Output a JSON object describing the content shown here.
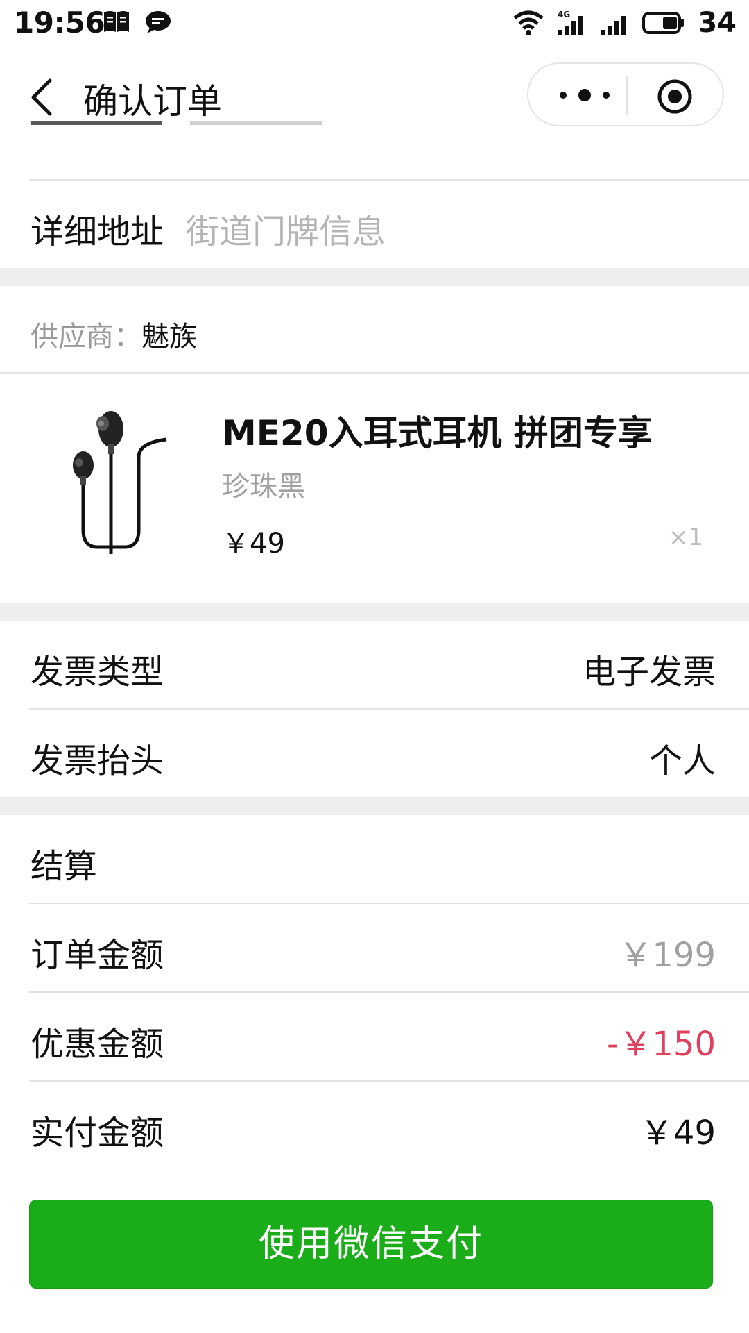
{
  "status_bar": {
    "time": "19:56",
    "battery": "34",
    "network": "4G",
    "icons": [
      "book-icon",
      "chat-icon",
      "wifi-icon",
      "signal-4g-icon",
      "signal-icon",
      "battery-icon"
    ]
  },
  "nav": {
    "title": "确认订单",
    "back_icon": "chevron-left-icon",
    "more_icon": "more-dots-icon",
    "close_icon": "target-circle-icon"
  },
  "address": {
    "detail_label": "详细地址",
    "detail_placeholder": "街道门牌信息"
  },
  "supplier": {
    "label": "供应商：",
    "name": "魅族"
  },
  "product": {
    "name": "ME20入耳式耳机 拼团专享",
    "color": "珍珠黑",
    "price": "￥49",
    "quantity": "×1",
    "image_icon": "earphones-image"
  },
  "invoice": {
    "type_label": "发票类型",
    "type_value": "电子发票",
    "title_label": "发票抬头",
    "title_value": "个人"
  },
  "settlement": {
    "header": "结算",
    "order_amount_label": "订单金额",
    "order_amount_value": "￥199",
    "discount_label": "优惠金额",
    "discount_value": "-￥150",
    "paid_label": "实付金额",
    "paid_value": "￥49"
  },
  "colors": {
    "pay_button": "#1aad19",
    "discount": "#e0405e",
    "separator_band": "#eeeeee"
  },
  "pay_button_label": "使用微信支付"
}
